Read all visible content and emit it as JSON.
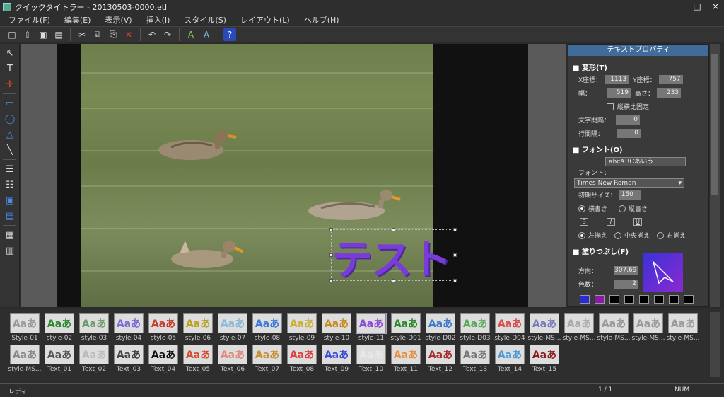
{
  "window": {
    "title": "クイックタイトラー - 20130503-0000.etl",
    "minimize": "_",
    "maximize": "□",
    "close": "×"
  },
  "menu": [
    "ファイル(F)",
    "編集(E)",
    "表示(V)",
    "挿入(I)",
    "スタイル(S)",
    "レイアウト(L)",
    "ヘルプ(H)"
  ],
  "toolbar": {
    "new": "□",
    "open": "⇧",
    "save": "▣",
    "saveall": "▤",
    "cut": "✂",
    "copy": "⧉",
    "paste": "⎘",
    "delete": "✕",
    "undo": "↶",
    "redo": "↷",
    "text_a": "A",
    "text_b": "A",
    "help": "?"
  },
  "tools": {
    "select": "↖",
    "text": "T",
    "crop": "✛",
    "rect": "▭",
    "ellipse": "◯",
    "triangle": "△",
    "line": "╲",
    "align1": "☰",
    "align2": "☷",
    "layer1": "▣",
    "layer2": "▤",
    "grid": "▦",
    "table": "▥"
  },
  "canvas": {
    "text": "テスト"
  },
  "panel": {
    "title": "テキストプロパティ",
    "transform": {
      "header": "変形(T)",
      "x_label": "X座標：",
      "x": "1113",
      "y_label": "Y座標：",
      "y": "757",
      "w_label": "幅：",
      "w": "519",
      "h_label": "高さ：",
      "h": "233",
      "aspect_label": "縦横比固定",
      "char_spacing_label": "文字間隔：",
      "char_spacing": "0",
      "line_spacing_label": "行間隔：",
      "line_spacing": "0"
    },
    "font": {
      "header": "フォント(O)",
      "preview": "abcABCあいう",
      "font_label": "フォント：",
      "font_name": "Times New Roman",
      "size_label": "初期サイズ：",
      "size": "150",
      "horizontal": "横書き",
      "vertical": "縦書き",
      "bold": "B",
      "italic": "I",
      "underline": "U",
      "align_left": "左揃え",
      "align_center": "中央揃え",
      "align_right": "右揃え"
    },
    "fill": {
      "header": "塗りつぶし(F)",
      "direction_label": "方向：",
      "direction": "307.69",
      "colors_label": "色数：",
      "colors": "2",
      "swatch_colors": [
        "#2a2ad8",
        "#8a1aa8",
        "#000000",
        "#000000",
        "#000000",
        "#000000",
        "#000000",
        "#000000"
      ]
    }
  },
  "styles": {
    "row1": [
      {
        "label": "Style-01",
        "glyph": "Aaあ",
        "color": "#999"
      },
      {
        "label": "style-02",
        "glyph": "Aaあ",
        "color": "#2a8a2a"
      },
      {
        "label": "style-03",
        "glyph": "Aaあ",
        "color": "#6a9a6a"
      },
      {
        "label": "style-04",
        "glyph": "Aaあ",
        "color": "#7a6ad8"
      },
      {
        "label": "style-05",
        "glyph": "Aaあ",
        "color": "#c83a2a"
      },
      {
        "label": "style-06",
        "glyph": "Aaあ",
        "color": "#b8a020"
      },
      {
        "label": "style-07",
        "glyph": "Aaあ",
        "color": "#8ab8d8"
      },
      {
        "label": "style-08",
        "glyph": "Aaあ",
        "color": "#3a7ad8"
      },
      {
        "label": "style-09",
        "glyph": "Aaあ",
        "color": "#c8b030"
      },
      {
        "label": "style-10",
        "glyph": "Aaあ",
        "color": "#c88a20"
      },
      {
        "label": "style-11",
        "glyph": "Aaあ",
        "color": "#8a4ad8"
      },
      {
        "label": "style-D01",
        "glyph": "Aaあ",
        "color": "#2a8a2a"
      },
      {
        "label": "style-D02",
        "glyph": "Aaあ",
        "color": "#3a7ac8"
      },
      {
        "label": "style-D03",
        "glyph": "Aaあ",
        "color": "#5aa85a"
      },
      {
        "label": "style-D04",
        "glyph": "Aaあ",
        "color": "#d84a4a"
      },
      {
        "label": "style-MS...",
        "glyph": "Aaあ",
        "color": "#7a7ab8"
      },
      {
        "label": "style-MS...",
        "glyph": "Aaあ",
        "color": "#aaa"
      },
      {
        "label": "style-MS...",
        "glyph": "Aaあ",
        "color": "#999"
      },
      {
        "label": "style-MS...",
        "glyph": "Aaあ",
        "color": "#999"
      },
      {
        "label": "style-MS...",
        "glyph": "Aaあ",
        "color": "#999"
      }
    ],
    "row2": [
      {
        "label": "style-MS...",
        "glyph": "Aaあ",
        "color": "#888"
      },
      {
        "label": "Text_01",
        "glyph": "Aaあ",
        "color": "#555"
      },
      {
        "label": "Text_02",
        "glyph": "Aaあ",
        "color": "#bbb"
      },
      {
        "label": "Text_03",
        "glyph": "Aaあ",
        "color": "#444"
      },
      {
        "label": "Text_04",
        "glyph": "Aaあ",
        "color": "#111"
      },
      {
        "label": "Text_05",
        "glyph": "Aaあ",
        "color": "#d84a2a"
      },
      {
        "label": "Text_06",
        "glyph": "Aaあ",
        "color": "#e08a7a"
      },
      {
        "label": "Text_07",
        "glyph": "Aaあ",
        "color": "#c89030"
      },
      {
        "label": "Text_08",
        "glyph": "Aaあ",
        "color": "#e03a3a"
      },
      {
        "label": "Text_09",
        "glyph": "Aaあ",
        "color": "#3a4ad8"
      },
      {
        "label": "Text_10",
        "glyph": "Aaあ",
        "color": "#e8e8e8"
      },
      {
        "label": "Text_11",
        "glyph": "Aaあ",
        "color": "#e89040"
      },
      {
        "label": "Text_12",
        "glyph": "Aaあ",
        "color": "#a82a2a"
      },
      {
        "label": "Text_13",
        "glyph": "Aaあ",
        "color": "#777"
      },
      {
        "label": "Text_14",
        "glyph": "Aaあ",
        "color": "#4a9ad8"
      },
      {
        "label": "Text_15",
        "glyph": "Aaあ",
        "color": "#8a1a1a"
      }
    ]
  },
  "status": {
    "left": "レディ",
    "page": "1 / 1",
    "num": "NUM"
  }
}
